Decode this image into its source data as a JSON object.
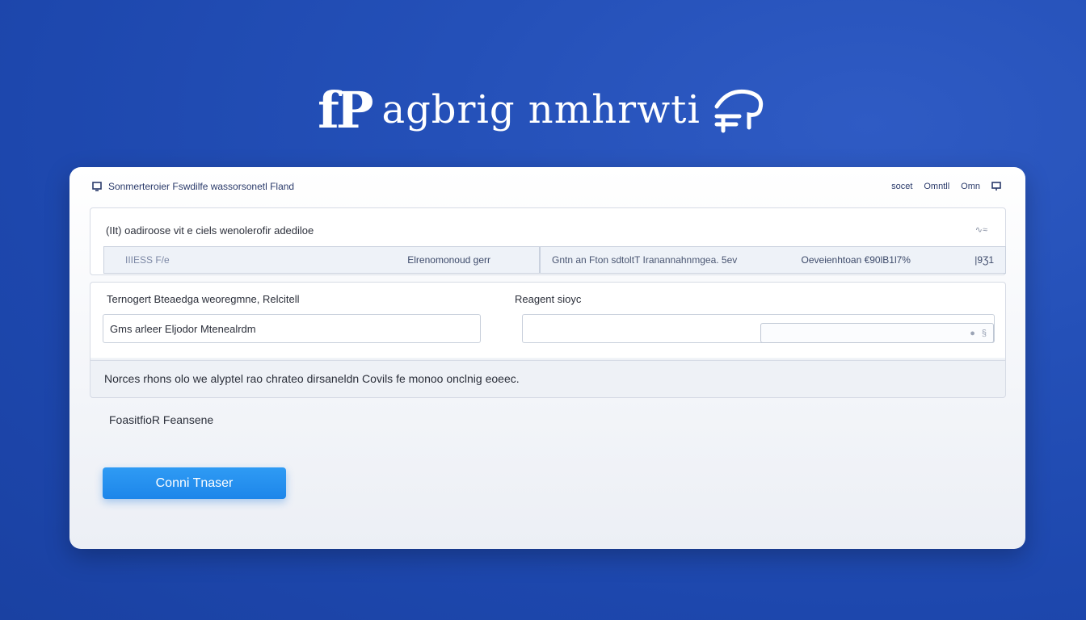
{
  "brand": {
    "mark": "fP",
    "title": "agbrig nmhrwti"
  },
  "header": {
    "title": "Sonmerteroier Fswdilfe  wassorsonetl Fland",
    "links": [
      "socet",
      "Omntll",
      "Omn"
    ]
  },
  "section1": {
    "title": "(IIt) oadiroose vit e ciels wenolerofir adediloe",
    "corner": "∿≈",
    "row": {
      "left_label": "IIIESS F/e",
      "left_value": "Elrenomonoud gerr",
      "mid_text": "Gntn an Fton sdtoltT Iranannahnmgea. 5ev",
      "right_value": "Oeveienhtoan €90lB1l7%",
      "right_end": "|9Ʒ1"
    }
  },
  "section2": {
    "field1_label": "Ternogert Bteaedga weoregmne, Relcitell",
    "field1_value": "Gms arleer Eljodor Mtenealrdm",
    "field2_label": "Reagent sioyc",
    "field2_value": "",
    "notice": "Norces rhons olo we alyptel rao chrateo dirsaneldn Covils fe monoo onclnig eoeec."
  },
  "footer": {
    "label": "FoasitfioR Feansene",
    "button": "Conni Tnaser"
  }
}
